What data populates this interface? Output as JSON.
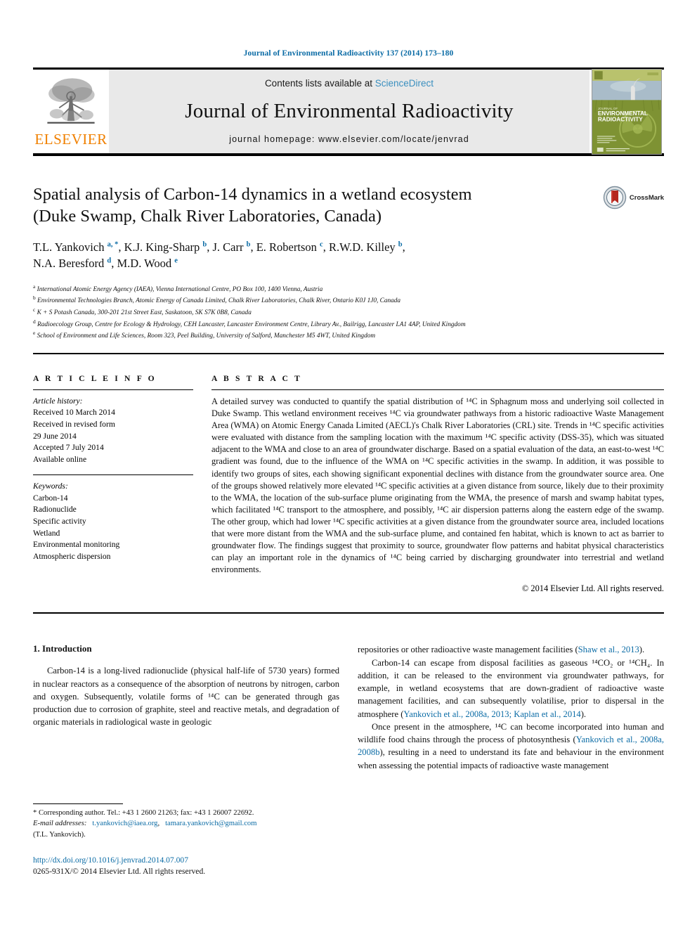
{
  "running_head": "Journal of Environmental Radioactivity 137 (2014) 173–180",
  "masthead": {
    "publisher_name": "ELSEVIER",
    "contents_prefix": "Contents lists available at ",
    "contents_link": "ScienceDirect",
    "journal_title": "Journal of Environmental Radioactivity",
    "homepage_label": "journal homepage: www.elsevier.com/locate/jenvrad",
    "cover_caption": "JOURNAL OF ENVIRONMENTAL RADIOACTIVITY"
  },
  "article": {
    "title_line1": "Spatial analysis of Carbon-14 dynamics in a wetland ecosystem",
    "title_line2": "(Duke Swamp, Chalk River Laboratories, Canada)",
    "crossmark_label": "CrossMark",
    "authors": [
      {
        "name": "T.L. Yankovich",
        "marks": "a, *"
      },
      {
        "name": "K.J. King-Sharp",
        "marks": "b"
      },
      {
        "name": "J. Carr",
        "marks": "b"
      },
      {
        "name": "E. Robertson",
        "marks": "c"
      },
      {
        "name": "R.W.D. Killey",
        "marks": "b"
      },
      {
        "name": "N.A. Beresford",
        "marks": "d"
      },
      {
        "name": "M.D. Wood",
        "marks": "e"
      }
    ],
    "affiliations": [
      {
        "mark": "a",
        "text": "International Atomic Energy Agency (IAEA), Vienna International Centre, PO Box 100, 1400 Vienna, Austria"
      },
      {
        "mark": "b",
        "text": "Environmental Technologies Branch, Atomic Energy of Canada Limited, Chalk River Laboratories, Chalk River, Ontario K0J 1J0, Canada"
      },
      {
        "mark": "c",
        "text": "K + S Potash Canada, 300-201 21st Street East, Saskatoon, SK S7K 0B8, Canada"
      },
      {
        "mark": "d",
        "text": "Radioecology Group, Centre for Ecology & Hydrology, CEH Lancaster, Lancaster Environment Centre, Library Av., Bailrigg, Lancaster LA1 4AP, United Kingdom"
      },
      {
        "mark": "e",
        "text": "School of Environment and Life Sciences, Room 323, Peel Building, University of Salford, Manchester M5 4WT, United Kingdom"
      }
    ]
  },
  "article_info": {
    "heading": "A R T I C L E   I N F O",
    "history_label": "Article history:",
    "history": [
      "Received 10 March 2014",
      "Received in revised form",
      "29 June 2014",
      "Accepted 7 July 2014",
      "Available online"
    ],
    "keywords_label": "Keywords:",
    "keywords": [
      "Carbon-14",
      "Radionuclide",
      "Specific activity",
      "Wetland",
      "Environmental monitoring",
      "Atmospheric dispersion"
    ]
  },
  "abstract": {
    "heading": "A B S T R A C T",
    "text": "A detailed survey was conducted to quantify the spatial distribution of ¹⁴C in Sphagnum moss and underlying soil collected in Duke Swamp. This wetland environment receives ¹⁴C via groundwater pathways from a historic radioactive Waste Management Area (WMA) on Atomic Energy Canada Limited (AECL)'s Chalk River Laboratories (CRL) site. Trends in ¹⁴C specific activities were evaluated with distance from the sampling location with the maximum ¹⁴C specific activity (DSS-35), which was situated adjacent to the WMA and close to an area of groundwater discharge. Based on a spatial evaluation of the data, an east-to-west ¹⁴C gradient was found, due to the influence of the WMA on ¹⁴C specific activities in the swamp. In addition, it was possible to identify two groups of sites, each showing significant exponential declines with distance from the groundwater source area. One of the groups showed relatively more elevated ¹⁴C specific activities at a given distance from source, likely due to their proximity to the WMA, the location of the sub-surface plume originating from the WMA, the presence of marsh and swamp habitat types, which facilitated ¹⁴C transport to the atmosphere, and possibly, ¹⁴C air dispersion patterns along the eastern edge of the swamp. The other group, which had lower ¹⁴C specific activities at a given distance from the groundwater source area, included locations that were more distant from the WMA and the sub-surface plume, and contained fen habitat, which is known to act as barrier to groundwater flow. The findings suggest that proximity to source, groundwater flow patterns and habitat physical characteristics can play an important role in the dynamics of ¹⁴C being carried by discharging groundwater into terrestrial and wetland environments.",
    "copyright": "© 2014 Elsevier Ltd. All rights reserved."
  },
  "introduction": {
    "heading": "1. Introduction",
    "left_paragraph": "Carbon-14 is a long-lived radionuclide (physical half-life of 5730 years) formed in nuclear reactors as a consequence of the absorption of neutrons by nitrogen, carbon and oxygen. Subsequently, volatile forms of ¹⁴C can be generated through gas production due to corrosion of graphite, steel and reactive metals, and degradation of organic materials in radiological waste in geologic",
    "right_p1_a": "repositories or other radioactive waste management facilities (",
    "right_p1_ref": "Shaw et al., 2013",
    "right_p1_b": ").",
    "right_p2_a": "Carbon-14 can escape from disposal facilities as gaseous ¹⁴CO₂ or ¹⁴CH₄. In addition, it can be released to the environment via groundwater pathways, for example, in wetland ecosystems that are down-gradient of radioactive waste management facilities, and can subsequently volatilise, prior to dispersal in the atmosphere (",
    "right_p2_ref": "Yankovich et al., 2008a, 2013; Kaplan et al., 2014",
    "right_p2_b": ").",
    "right_p3_a": "Once present in the atmosphere, ¹⁴C can become incorporated into human and wildlife food chains through the process of photosynthesis (",
    "right_p3_ref": "Yankovich et al., 2008a, 2008b",
    "right_p3_b": "), resulting in a need to understand its fate and behaviour in the environment when assessing the potential impacts of radioactive waste management"
  },
  "footnotes": {
    "corresponding": "* Corresponding author. Tel.: +43 1 2600 21263; fax: +43 1 26007 22692.",
    "email_label": "E-mail addresses:",
    "email1": "t.yankovich@iaea.org",
    "email_sep": ",",
    "email2": "tamara.yankovich@gmail.com",
    "email_owner": "(T.L. Yankovich)."
  },
  "footer": {
    "doi": "http://dx.doi.org/10.1016/j.jenvrad.2014.07.007",
    "issn_line": "0265-931X/© 2014 Elsevier Ltd. All rights reserved."
  },
  "colors": {
    "link": "#0a6ba5",
    "elsevier_orange": "#f08000",
    "masthead_gray": "#e9e9e9"
  }
}
